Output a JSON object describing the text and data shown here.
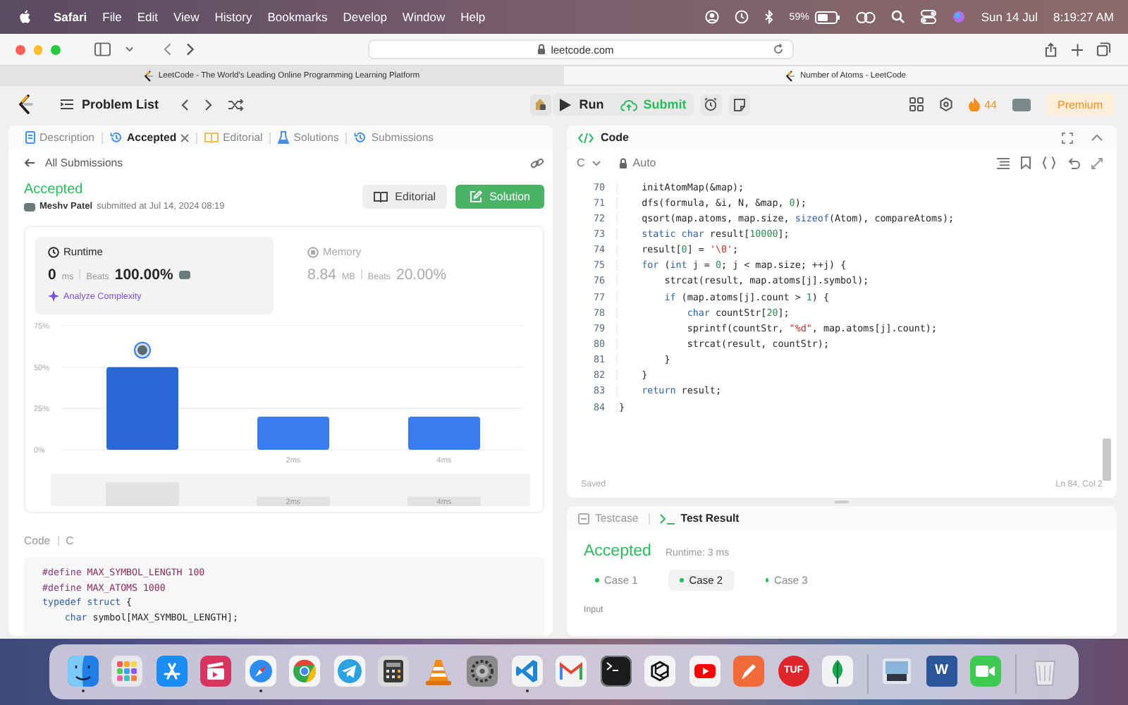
{
  "menubar": {
    "app": "Safari",
    "menus": [
      "File",
      "Edit",
      "View",
      "History",
      "Bookmarks",
      "Develop",
      "Window",
      "Help"
    ],
    "battery": "59%",
    "date": "Sun 14 Jul",
    "time": "8:19:27 AM"
  },
  "browser": {
    "address": "leetcode.com",
    "tabs": [
      {
        "title": "LeetCode - The World's Leading Online Programming Learning Platform",
        "selected": false
      },
      {
        "title": "Number of Atoms - LeetCode",
        "selected": true
      }
    ]
  },
  "navbar": {
    "problem_list": "Problem List",
    "run": "Run",
    "submit": "Submit",
    "streak": "44",
    "premium": "Premium"
  },
  "left_panel": {
    "tabs": [
      {
        "label": "Description",
        "kind": "document",
        "selected": false,
        "closable": false
      },
      {
        "label": "Accepted",
        "kind": "history",
        "selected": true,
        "closable": true
      },
      {
        "label": "Editorial",
        "kind": "book",
        "selected": false,
        "closable": false
      },
      {
        "label": "Solutions",
        "kind": "flask",
        "selected": false,
        "closable": false
      },
      {
        "label": "Submissions",
        "kind": "history",
        "selected": false,
        "closable": false
      }
    ],
    "back_link": "All Submissions",
    "status": "Accepted",
    "author": "Meshv Patel",
    "submitted": "submitted at Jul 14, 2024 08:19",
    "editorial_button": "Editorial",
    "solution_button": "Solution",
    "metrics": [
      {
        "label": "Runtime",
        "kind": "clock",
        "value": "0",
        "unit": "ms",
        "beats_label": "Beats",
        "percent": "100.00%",
        "selected": true,
        "action": "Analyze Complexity"
      },
      {
        "label": "Memory",
        "kind": "chip",
        "value": "8.84",
        "unit": "MB",
        "beats_label": "Beats",
        "percent": "20.00%",
        "selected": false
      }
    ],
    "chart_data": {
      "type": "bar",
      "categories": [
        null,
        "2ms",
        "4ms"
      ],
      "values": [
        50,
        20,
        20
      ],
      "ylim": [
        0,
        75
      ],
      "yticks": [
        {
          "value": 0,
          "label": "0%"
        },
        {
          "value": 25,
          "label": "25%"
        },
        {
          "value": 50,
          "label": "50%"
        },
        {
          "value": 75,
          "label": "75%"
        }
      ]
    },
    "overview_labels": [
      "2ms",
      "4ms"
    ],
    "code_label": "Code",
    "code_language": "C",
    "code": [
      {
        "tokens": [
          {
            "t": "#define",
            "kind": "pp"
          },
          {
            "t": " MAX_SYMBOL_LENGTH 100",
            "kind": "macro"
          }
        ]
      },
      {
        "tokens": [
          {
            "t": "#define",
            "kind": "pp"
          },
          {
            "t": " MAX_ATOMS 1000",
            "kind": "macro"
          }
        ]
      },
      {
        "tokens": [
          {
            "t": "typedef struct",
            "kind": "kw"
          },
          {
            "t": " {",
            "kind": "plain"
          }
        ]
      },
      {
        "tokens": [
          {
            "t": "    char",
            "kind": "kw"
          },
          {
            "t": " symbol[MAX_SYMBOL_LENGTH];",
            "kind": "plain"
          }
        ]
      }
    ]
  },
  "editor": {
    "title": "Code",
    "language": "C",
    "mode": "Auto",
    "status": "Saved",
    "cursor": "Ln 84, Col 2",
    "lines": [
      {
        "number": "70",
        "tokens": [
          {
            "t": "    initAtomMap(&map);",
            "kind": "plain"
          }
        ]
      },
      {
        "number": "71",
        "tokens": [
          {
            "t": "    dfs(formula, &i, N, &map, ",
            "kind": "plain"
          },
          {
            "t": "0",
            "kind": "num"
          },
          {
            "t": ");",
            "kind": "plain"
          }
        ]
      },
      {
        "number": "72",
        "tokens": [
          {
            "t": "    qsort(map.atoms, map.size, ",
            "kind": "plain"
          },
          {
            "t": "sizeof",
            "kind": "kw"
          },
          {
            "t": "(Atom), compareAtoms);",
            "kind": "plain"
          }
        ]
      },
      {
        "number": "73",
        "tokens": [
          {
            "t": "    static char",
            "kind": "kw"
          },
          {
            "t": " result[",
            "kind": "plain"
          },
          {
            "t": "10000",
            "kind": "num"
          },
          {
            "t": "];",
            "kind": "plain"
          }
        ]
      },
      {
        "number": "74",
        "tokens": [
          {
            "t": "    result[",
            "kind": "plain"
          },
          {
            "t": "0",
            "kind": "num"
          },
          {
            "t": "] = ",
            "kind": "plain"
          },
          {
            "t": "'\\0'",
            "kind": "str"
          },
          {
            "t": ";",
            "kind": "plain"
          }
        ]
      },
      {
        "number": "75",
        "tokens": [
          {
            "t": "    for",
            "kind": "kw"
          },
          {
            "t": " (",
            "kind": "plain"
          },
          {
            "t": "int",
            "kind": "kw"
          },
          {
            "t": " j = ",
            "kind": "plain"
          },
          {
            "t": "0",
            "kind": "num"
          },
          {
            "t": "; j < map.size; ++j) {",
            "kind": "plain"
          }
        ]
      },
      {
        "number": "76",
        "tokens": [
          {
            "t": "        strcat(result, map.atoms[j].symbol);",
            "kind": "plain"
          }
        ]
      },
      {
        "number": "77",
        "tokens": [
          {
            "t": "        if",
            "kind": "kw"
          },
          {
            "t": " (map.atoms[j].count > ",
            "kind": "plain"
          },
          {
            "t": "1",
            "kind": "num"
          },
          {
            "t": ") {",
            "kind": "plain"
          }
        ]
      },
      {
        "number": "78",
        "tokens": [
          {
            "t": "            char",
            "kind": "kw"
          },
          {
            "t": " countStr[",
            "kind": "plain"
          },
          {
            "t": "20",
            "kind": "num"
          },
          {
            "t": "];",
            "kind": "plain"
          }
        ]
      },
      {
        "number": "79",
        "tokens": [
          {
            "t": "            sprintf(countStr, ",
            "kind": "plain"
          },
          {
            "t": "\"%d\"",
            "kind": "str"
          },
          {
            "t": ", map.atoms[j].count);",
            "kind": "plain"
          }
        ]
      },
      {
        "number": "80",
        "tokens": [
          {
            "t": "            strcat(result, countStr);",
            "kind": "plain"
          }
        ]
      },
      {
        "number": "81",
        "tokens": [
          {
            "t": "        }",
            "kind": "plain"
          }
        ]
      },
      {
        "number": "82",
        "tokens": [
          {
            "t": "    }",
            "kind": "plain"
          }
        ]
      },
      {
        "number": "83",
        "tokens": [
          {
            "t": "    return",
            "kind": "kw"
          },
          {
            "t": " result;",
            "kind": "plain"
          }
        ]
      },
      {
        "number": "84",
        "tokens": [
          {
            "t": "}",
            "kind": "plain"
          }
        ]
      }
    ]
  },
  "console": {
    "tabs": [
      {
        "label": "Testcase",
        "kind": "checkbox",
        "selected": false
      },
      {
        "label": "Test Result",
        "kind": "terminal",
        "selected": true
      }
    ],
    "status": "Accepted",
    "runtime": "Runtime: 3 ms",
    "cases": [
      {
        "label": "Case 1",
        "passed": true,
        "selected": false
      },
      {
        "label": "Case 2",
        "passed": true,
        "selected": true
      },
      {
        "label": "Case 3",
        "passed": true,
        "selected": false
      }
    ],
    "input_label": "Input"
  },
  "dock": {
    "apps": [
      {
        "kind": "finder",
        "running": true
      },
      {
        "kind": "launchpad",
        "running": false
      },
      {
        "kind": "appstore",
        "running": false
      },
      {
        "kind": "clapper",
        "running": false
      },
      {
        "kind": "compass",
        "running": true
      },
      {
        "kind": "chrome",
        "running": false
      },
      {
        "kind": "telegram",
        "running": false
      },
      {
        "kind": "calculator",
        "running": false
      },
      {
        "kind": "cone",
        "running": false
      },
      {
        "kind": "gear",
        "running": false
      },
      {
        "kind": "vscode",
        "running": true
      },
      {
        "kind": "mail",
        "running": false
      },
      {
        "kind": "terminal",
        "running": false
      },
      {
        "kind": "knot",
        "running": false
      },
      {
        "kind": "youtube",
        "running": false
      },
      {
        "kind": "pen",
        "running": false
      },
      {
        "kind": "badge",
        "label": "TUF",
        "running": false
      },
      {
        "kind": "leaf",
        "running": false
      },
      {
        "kind": "divider"
      },
      {
        "kind": "photo",
        "running": false
      },
      {
        "kind": "document",
        "label": "W",
        "running": false
      },
      {
        "kind": "camera",
        "running": false
      },
      {
        "kind": "divider"
      },
      {
        "kind": "trash",
        "running": false
      }
    ]
  }
}
